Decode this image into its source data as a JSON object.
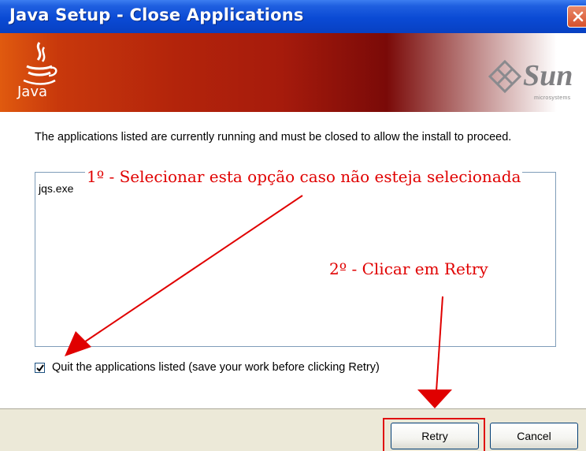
{
  "window": {
    "title": "Java Setup - Close Applications"
  },
  "banner": {
    "java_logo_text": "Java",
    "sun_logo_text": "Sun",
    "sun_subtext": "microsystems"
  },
  "main": {
    "message": "The applications listed are currently running and must be closed to allow the install to proceed.",
    "applications": [
      "jqs.exe"
    ],
    "quit_checkbox": {
      "label": "Quit the applications listed (save your work before clicking Retry)",
      "checked": true
    }
  },
  "buttons": {
    "retry": "Retry",
    "cancel": "Cancel"
  },
  "annotations": {
    "step1": "1º - Selecionar esta opção caso não esteja selecionada",
    "step2": "2º - Clicar em Retry"
  },
  "colors": {
    "titlebar": "#0a4ad4",
    "banner_start": "#e05a0f",
    "banner_mid": "#a61b0c",
    "annotation": "#e00000"
  }
}
